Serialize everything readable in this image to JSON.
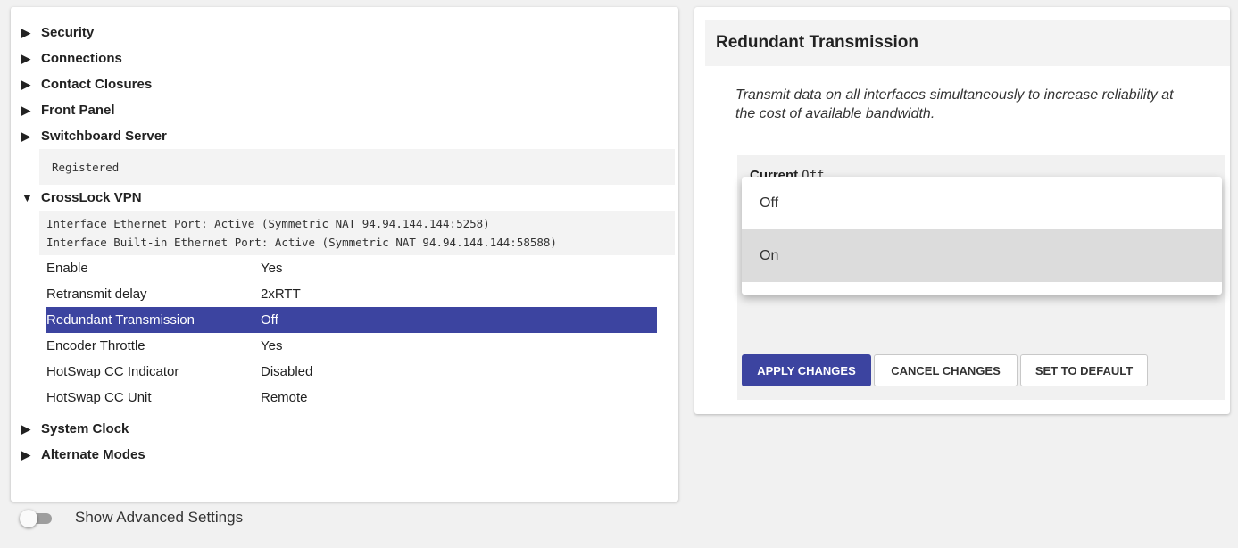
{
  "tree": {
    "arrow_collapsed": "▶",
    "arrow_expanded": "▼",
    "nodes": [
      "Security",
      "Connections",
      "Contact Closures",
      "Front Panel",
      "Switchboard Server"
    ],
    "switchboard_status": "Registered",
    "crosslock": {
      "label": "CrossLock VPN",
      "interfaces": [
        "Interface Ethernet Port: Active (Symmetric NAT 94.94.144.144:5258)",
        "Interface Built-in Ethernet Port: Active (Symmetric NAT 94.94.144.144:58588)"
      ],
      "properties": [
        {
          "key": "Enable",
          "value": "Yes"
        },
        {
          "key": "Retransmit delay",
          "value": "2xRTT"
        },
        {
          "key": "Redundant Transmission",
          "value": "Off"
        },
        {
          "key": "Encoder Throttle",
          "value": "Yes"
        },
        {
          "key": "HotSwap CC Indicator",
          "value": "Disabled"
        },
        {
          "key": "HotSwap CC Unit",
          "value": "Remote"
        }
      ]
    },
    "nodes_after": [
      "System Clock",
      "Alternate Modes"
    ]
  },
  "advanced": {
    "label": "Show Advanced Settings",
    "enabled": false
  },
  "detail": {
    "title": "Redundant Transmission",
    "description": "Transmit data on all interfaces simultaneously to increase reliability at the cost of available bandwidth.",
    "current_label": "Current",
    "current_value": "Off",
    "options": [
      "Off",
      "On"
    ]
  },
  "buttons": {
    "apply": "APPLY CHANGES",
    "cancel": "CANCEL CHANGES",
    "default": "SET TO DEFAULT"
  },
  "colors": {
    "accent": "#3c44a0",
    "hover": "#dcdcdc"
  }
}
